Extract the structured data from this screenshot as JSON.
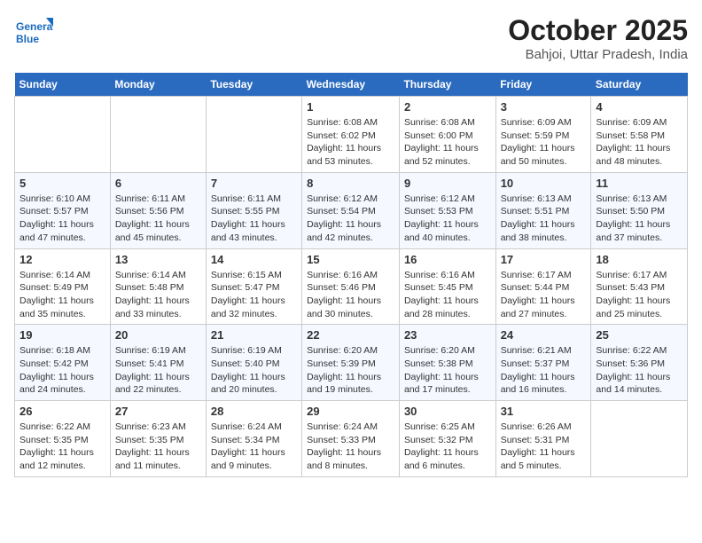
{
  "header": {
    "logo_line1": "General",
    "logo_line2": "Blue",
    "month": "October 2025",
    "location": "Bahjoi, Uttar Pradesh, India"
  },
  "days_of_week": [
    "Sunday",
    "Monday",
    "Tuesday",
    "Wednesday",
    "Thursday",
    "Friday",
    "Saturday"
  ],
  "weeks": [
    [
      {
        "day": "",
        "content": ""
      },
      {
        "day": "",
        "content": ""
      },
      {
        "day": "",
        "content": ""
      },
      {
        "day": "1",
        "content": "Sunrise: 6:08 AM\nSunset: 6:02 PM\nDaylight: 11 hours\nand 53 minutes."
      },
      {
        "day": "2",
        "content": "Sunrise: 6:08 AM\nSunset: 6:00 PM\nDaylight: 11 hours\nand 52 minutes."
      },
      {
        "day": "3",
        "content": "Sunrise: 6:09 AM\nSunset: 5:59 PM\nDaylight: 11 hours\nand 50 minutes."
      },
      {
        "day": "4",
        "content": "Sunrise: 6:09 AM\nSunset: 5:58 PM\nDaylight: 11 hours\nand 48 minutes."
      }
    ],
    [
      {
        "day": "5",
        "content": "Sunrise: 6:10 AM\nSunset: 5:57 PM\nDaylight: 11 hours\nand 47 minutes."
      },
      {
        "day": "6",
        "content": "Sunrise: 6:11 AM\nSunset: 5:56 PM\nDaylight: 11 hours\nand 45 minutes."
      },
      {
        "day": "7",
        "content": "Sunrise: 6:11 AM\nSunset: 5:55 PM\nDaylight: 11 hours\nand 43 minutes."
      },
      {
        "day": "8",
        "content": "Sunrise: 6:12 AM\nSunset: 5:54 PM\nDaylight: 11 hours\nand 42 minutes."
      },
      {
        "day": "9",
        "content": "Sunrise: 6:12 AM\nSunset: 5:53 PM\nDaylight: 11 hours\nand 40 minutes."
      },
      {
        "day": "10",
        "content": "Sunrise: 6:13 AM\nSunset: 5:51 PM\nDaylight: 11 hours\nand 38 minutes."
      },
      {
        "day": "11",
        "content": "Sunrise: 6:13 AM\nSunset: 5:50 PM\nDaylight: 11 hours\nand 37 minutes."
      }
    ],
    [
      {
        "day": "12",
        "content": "Sunrise: 6:14 AM\nSunset: 5:49 PM\nDaylight: 11 hours\nand 35 minutes."
      },
      {
        "day": "13",
        "content": "Sunrise: 6:14 AM\nSunset: 5:48 PM\nDaylight: 11 hours\nand 33 minutes."
      },
      {
        "day": "14",
        "content": "Sunrise: 6:15 AM\nSunset: 5:47 PM\nDaylight: 11 hours\nand 32 minutes."
      },
      {
        "day": "15",
        "content": "Sunrise: 6:16 AM\nSunset: 5:46 PM\nDaylight: 11 hours\nand 30 minutes."
      },
      {
        "day": "16",
        "content": "Sunrise: 6:16 AM\nSunset: 5:45 PM\nDaylight: 11 hours\nand 28 minutes."
      },
      {
        "day": "17",
        "content": "Sunrise: 6:17 AM\nSunset: 5:44 PM\nDaylight: 11 hours\nand 27 minutes."
      },
      {
        "day": "18",
        "content": "Sunrise: 6:17 AM\nSunset: 5:43 PM\nDaylight: 11 hours\nand 25 minutes."
      }
    ],
    [
      {
        "day": "19",
        "content": "Sunrise: 6:18 AM\nSunset: 5:42 PM\nDaylight: 11 hours\nand 24 minutes."
      },
      {
        "day": "20",
        "content": "Sunrise: 6:19 AM\nSunset: 5:41 PM\nDaylight: 11 hours\nand 22 minutes."
      },
      {
        "day": "21",
        "content": "Sunrise: 6:19 AM\nSunset: 5:40 PM\nDaylight: 11 hours\nand 20 minutes."
      },
      {
        "day": "22",
        "content": "Sunrise: 6:20 AM\nSunset: 5:39 PM\nDaylight: 11 hours\nand 19 minutes."
      },
      {
        "day": "23",
        "content": "Sunrise: 6:20 AM\nSunset: 5:38 PM\nDaylight: 11 hours\nand 17 minutes."
      },
      {
        "day": "24",
        "content": "Sunrise: 6:21 AM\nSunset: 5:37 PM\nDaylight: 11 hours\nand 16 minutes."
      },
      {
        "day": "25",
        "content": "Sunrise: 6:22 AM\nSunset: 5:36 PM\nDaylight: 11 hours\nand 14 minutes."
      }
    ],
    [
      {
        "day": "26",
        "content": "Sunrise: 6:22 AM\nSunset: 5:35 PM\nDaylight: 11 hours\nand 12 minutes."
      },
      {
        "day": "27",
        "content": "Sunrise: 6:23 AM\nSunset: 5:35 PM\nDaylight: 11 hours\nand 11 minutes."
      },
      {
        "day": "28",
        "content": "Sunrise: 6:24 AM\nSunset: 5:34 PM\nDaylight: 11 hours\nand 9 minutes."
      },
      {
        "day": "29",
        "content": "Sunrise: 6:24 AM\nSunset: 5:33 PM\nDaylight: 11 hours\nand 8 minutes."
      },
      {
        "day": "30",
        "content": "Sunrise: 6:25 AM\nSunset: 5:32 PM\nDaylight: 11 hours\nand 6 minutes."
      },
      {
        "day": "31",
        "content": "Sunrise: 6:26 AM\nSunset: 5:31 PM\nDaylight: 11 hours\nand 5 minutes."
      },
      {
        "day": "",
        "content": ""
      }
    ]
  ]
}
